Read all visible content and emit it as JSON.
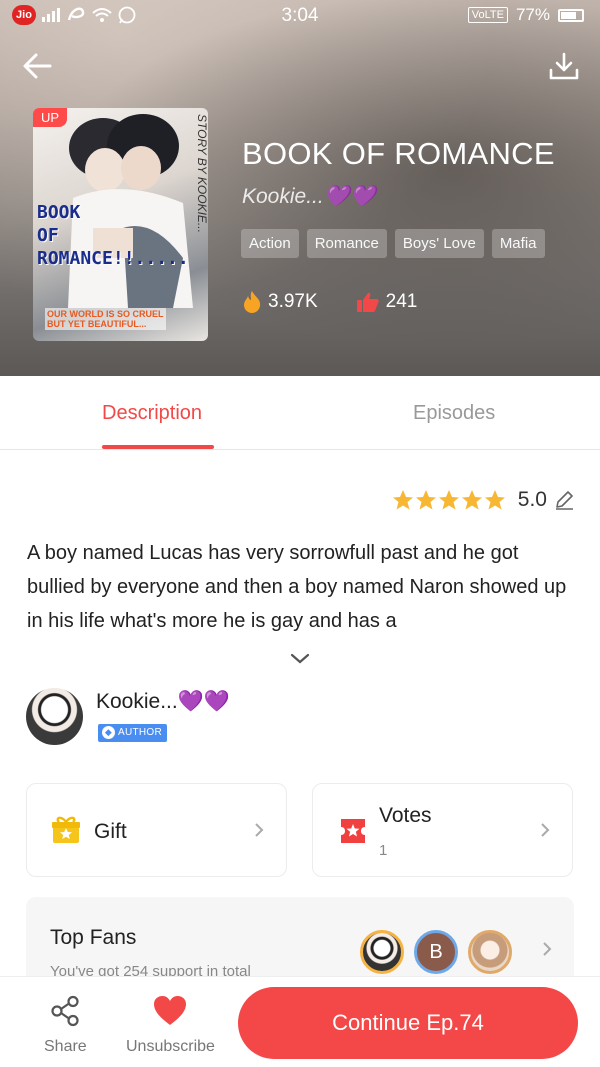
{
  "status_bar": {
    "time": "3:04",
    "carrier": "Jio",
    "network": "VoLTE",
    "battery": "77%"
  },
  "book": {
    "title": "BOOK OF ROMANCE",
    "author": "Kookie...💜💜",
    "badge": "UP",
    "cover_title": "BOOK\nOF\nROMANCE!!.....",
    "cover_byline": "STORY BY KOOKIE...",
    "cover_tagline": "OUR WORLD IS SO CRUEL\nBUT YET BEAUTIFUL...",
    "tags": [
      "Action",
      "Romance",
      "Boys' Love",
      "Mafia"
    ],
    "views": "3.97K",
    "likes": "241"
  },
  "tabs": [
    {
      "label": "Description",
      "active": true
    },
    {
      "label": "Episodes",
      "active": false
    }
  ],
  "rating": {
    "stars": 5,
    "value": "5.0"
  },
  "description": "A boy named Lucas has very sorrowfull past and he got bullied by everyone and then a boy named Naron showed up in his life what's more he is gay and has a",
  "author_section": {
    "name": "Kookie...💜💜",
    "badge": "AUTHOR"
  },
  "cards": {
    "gift": {
      "label": "Gift"
    },
    "votes": {
      "label": "Votes",
      "count": "1"
    }
  },
  "top_fans": {
    "title": "Top Fans",
    "subtitle": "You've got 254 support in total",
    "fan_b_initial": "B"
  },
  "bottom_bar": {
    "share": "Share",
    "unsubscribe": "Unsubscribe",
    "continue": "Continue Ep.74"
  },
  "colors": {
    "accent": "#f44848",
    "star": "#f7b733",
    "author_badge": "#4a8df0"
  }
}
